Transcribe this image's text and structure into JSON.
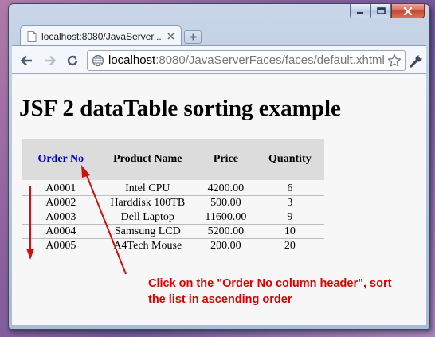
{
  "browser": {
    "tab_title": "localhost:8080/JavaServer...",
    "url_host": "localhost",
    "url_rest": ":8080/JavaServerFaces/faces/default.xhtml"
  },
  "page": {
    "heading": "JSF 2 dataTable sorting example"
  },
  "table": {
    "headers": {
      "order_no": "Order No",
      "product_name": "Product Name",
      "price": "Price",
      "quantity": "Quantity"
    },
    "rows": [
      {
        "order_no": "A0001",
        "product_name": "Intel CPU",
        "price": "4200.00",
        "quantity": "6"
      },
      {
        "order_no": "A0002",
        "product_name": "Harddisk 100TB",
        "price": "500.00",
        "quantity": "3"
      },
      {
        "order_no": "A0003",
        "product_name": "Dell Laptop",
        "price": "11600.00",
        "quantity": "9"
      },
      {
        "order_no": "A0004",
        "product_name": "Samsung LCD",
        "price": "5200.00",
        "quantity": "10"
      },
      {
        "order_no": "A0005",
        "product_name": "A4Tech Mouse",
        "price": "200.00",
        "quantity": "20"
      }
    ]
  },
  "annotation": {
    "line1": "Click on the \"Order No column header\", sort",
    "line2": "the list in ascending order",
    "color": "#dd0000"
  },
  "colors": {
    "link": "#0000cc",
    "header_bg": "#dcdcdc",
    "window_frame": "#b3c4dd"
  },
  "icons": [
    "minimize-icon",
    "maximize-icon",
    "close-icon",
    "page-icon",
    "tab-close-icon",
    "new-tab-icon",
    "back-arrow-icon",
    "forward-arrow-icon",
    "reload-icon",
    "globe-icon",
    "star-icon",
    "wrench-icon"
  ]
}
